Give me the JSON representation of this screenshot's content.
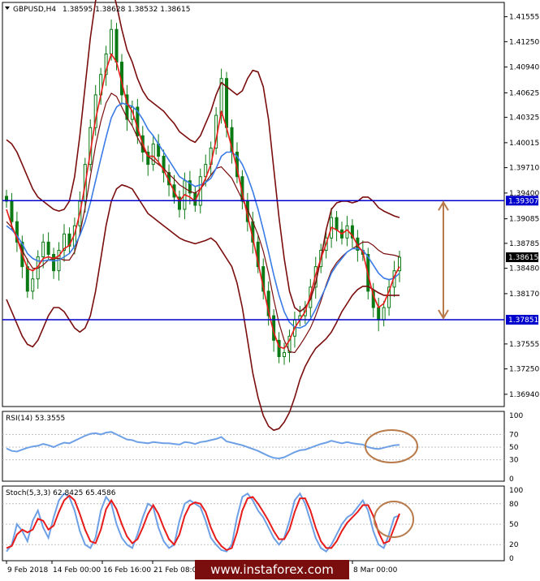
{
  "header": {
    "symbol": "GBPUSD,H4",
    "ohlc": "1.38595 1.38628 1.38532 1.38615"
  },
  "rsi_header": {
    "label": "RSI(14) 53.3555"
  },
  "stoch_header": {
    "label": "Stoch(5,3,3) 62.8425 65.4586"
  },
  "watermark": {
    "text": "www.instaforex.com"
  },
  "colors": {
    "background": "#ffffff",
    "candle": "#0b7a14",
    "bollinger": "#7a0d0d",
    "ma_fast": "#e81b1b",
    "ma_slow": "#3a7be6",
    "level_line": "#0000cc",
    "level_badge": "#0000cc",
    "last_price_badge": "#000000",
    "annotation": "#b87a4a",
    "indicator_line": "#6ea0e6",
    "stoch_signal": "#e81b1b",
    "watermark_bar": "#7a0d0d"
  },
  "chart_data": [
    {
      "type": "candlestick",
      "panel": "price",
      "ylim": [
        1.368,
        1.417
      ],
      "y_ticks": [
        "1.41555",
        "1.41250",
        "1.40940",
        "1.40625",
        "1.40325",
        "1.40015",
        "1.39710",
        "1.39400",
        "1.39085",
        "1.38785",
        "1.38480",
        "1.38170",
        "1.37555",
        "1.37250",
        "1.36940"
      ],
      "levels": [
        {
          "name": "resistance",
          "value": 1.39307,
          "label": "1.39307"
        },
        {
          "name": "support",
          "value": 1.37851,
          "label": "1.37851"
        }
      ],
      "last_price": {
        "value": 1.38615,
        "label": "1.38615"
      },
      "x_ticks": [
        "9 Feb 2018",
        "14 Feb 00:00",
        "16 Feb 16:00",
        "21 Feb 08:00",
        "8 Mar 00:00"
      ],
      "close": [
        1.393,
        1.3905,
        1.388,
        1.385,
        1.382,
        1.3835,
        1.3862,
        1.388,
        1.3865,
        1.3845,
        1.387,
        1.389,
        1.3875,
        1.39,
        1.393,
        1.3975,
        1.402,
        1.406,
        1.4085,
        1.411,
        1.414,
        1.41,
        1.406,
        1.403,
        1.4045,
        1.401,
        1.399,
        1.3975,
        1.4,
        1.3985,
        1.3965,
        1.395,
        1.3935,
        1.392,
        1.3955,
        1.394,
        1.3925,
        1.396,
        1.3975,
        1.3995,
        1.4035,
        1.408,
        1.402,
        1.399,
        1.396,
        1.393,
        1.3905,
        1.388,
        1.385,
        1.382,
        1.379,
        1.376,
        1.374,
        1.3745,
        1.3765,
        1.3785,
        1.379,
        1.38,
        1.3825,
        1.385,
        1.387,
        1.3885,
        1.391,
        1.3895,
        1.3885,
        1.39,
        1.3885,
        1.387,
        1.3865,
        1.382,
        1.38,
        1.3785,
        1.38,
        1.3825,
        1.3845,
        1.38615
      ],
      "ma_fast": [
        1.392,
        1.39,
        1.3885,
        1.3865,
        1.3848,
        1.3845,
        1.385,
        1.386,
        1.3862,
        1.386,
        1.3863,
        1.3872,
        1.3876,
        1.389,
        1.3915,
        1.395,
        1.399,
        1.403,
        1.406,
        1.409,
        1.411,
        1.41,
        1.4075,
        1.405,
        1.404,
        1.402,
        1.4,
        1.3985,
        1.3985,
        1.3978,
        1.3968,
        1.3955,
        1.3942,
        1.393,
        1.3938,
        1.3935,
        1.393,
        1.3945,
        1.3958,
        1.3975,
        1.4005,
        1.404,
        1.402,
        1.3995,
        1.397,
        1.394,
        1.3912,
        1.3885,
        1.3855,
        1.3825,
        1.3795,
        1.377,
        1.3752,
        1.375,
        1.376,
        1.3775,
        1.3785,
        1.3795,
        1.3815,
        1.384,
        1.386,
        1.3878,
        1.3898,
        1.3895,
        1.389,
        1.3895,
        1.3888,
        1.3876,
        1.3868,
        1.384,
        1.3815,
        1.38,
        1.3805,
        1.382,
        1.3838,
        1.385
      ],
      "ma_slow": [
        1.39,
        1.3895,
        1.3888,
        1.3878,
        1.3866,
        1.386,
        1.3857,
        1.3857,
        1.3858,
        1.3857,
        1.3858,
        1.3862,
        1.3866,
        1.3875,
        1.3888,
        1.3905,
        1.3928,
        1.3955,
        1.3982,
        1.4008,
        1.4032,
        1.4045,
        1.405,
        1.4048,
        1.4046,
        1.404,
        1.403,
        1.4018,
        1.401,
        1.4,
        1.399,
        1.398,
        1.397,
        1.396,
        1.3956,
        1.3952,
        1.3948,
        1.395,
        1.3953,
        1.3958,
        1.397,
        1.3985,
        1.399,
        1.399,
        1.3985,
        1.3975,
        1.396,
        1.3942,
        1.392,
        1.3895,
        1.3868,
        1.384,
        1.3815,
        1.3795,
        1.3782,
        1.3776,
        1.3775,
        1.3778,
        1.3786,
        1.3798,
        1.3812,
        1.3826,
        1.3842,
        1.3852,
        1.386,
        1.3868,
        1.3872,
        1.3872,
        1.387,
        1.3862,
        1.3852,
        1.3842,
        1.3836,
        1.3834,
        1.3836,
        1.3842
      ],
      "bb_upper": [
        1.4005,
        1.4,
        1.399,
        1.3975,
        1.396,
        1.3945,
        1.3935,
        1.393,
        1.3925,
        1.392,
        1.3918,
        1.392,
        1.393,
        1.396,
        1.401,
        1.407,
        1.413,
        1.4175,
        1.4195,
        1.42,
        1.4195,
        1.417,
        1.414,
        1.4115,
        1.41,
        1.408,
        1.4065,
        1.4055,
        1.405,
        1.4045,
        1.404,
        1.4032,
        1.4025,
        1.4015,
        1.401,
        1.4005,
        1.4002,
        1.401,
        1.4025,
        1.404,
        1.406,
        1.4075,
        1.407,
        1.4065,
        1.406,
        1.4065,
        1.408,
        1.409,
        1.4088,
        1.407,
        1.403,
        1.397,
        1.391,
        1.386,
        1.382,
        1.38,
        1.3795,
        1.38,
        1.381,
        1.383,
        1.386,
        1.3895,
        1.392,
        1.3928,
        1.393,
        1.393,
        1.3928,
        1.393,
        1.3935,
        1.3935,
        1.393,
        1.3922,
        1.3918,
        1.3915,
        1.3912,
        1.391
      ],
      "bb_lower": [
        1.381,
        1.3795,
        1.378,
        1.3765,
        1.3755,
        1.3752,
        1.376,
        1.3775,
        1.379,
        1.38,
        1.38,
        1.3795,
        1.3785,
        1.3775,
        1.377,
        1.3775,
        1.379,
        1.382,
        1.386,
        1.39,
        1.393,
        1.3945,
        1.395,
        1.3948,
        1.3945,
        1.3935,
        1.3925,
        1.3915,
        1.391,
        1.3905,
        1.39,
        1.3895,
        1.389,
        1.3885,
        1.3882,
        1.388,
        1.3878,
        1.388,
        1.3882,
        1.3885,
        1.388,
        1.387,
        1.386,
        1.385,
        1.383,
        1.38,
        1.376,
        1.372,
        1.369,
        1.3668,
        1.3655,
        1.365,
        1.3652,
        1.366,
        1.3672,
        1.369,
        1.3712,
        1.3728,
        1.374,
        1.375,
        1.3756,
        1.3762,
        1.377,
        1.3782,
        1.3795,
        1.3805,
        1.3815,
        1.3822,
        1.3826,
        1.3826,
        1.3822,
        1.3818,
        1.3815,
        1.3815,
        1.3815,
        1.3815
      ],
      "bb_mid": [
        1.3905,
        1.3898,
        1.3885,
        1.387,
        1.3858,
        1.3848,
        1.3848,
        1.3852,
        1.3858,
        1.386,
        1.386,
        1.3858,
        1.3858,
        1.3868,
        1.389,
        1.3922,
        1.396,
        1.3998,
        1.4028,
        1.405,
        1.4062,
        1.4058,
        1.4045,
        1.4032,
        1.4022,
        1.4008,
        1.3995,
        1.3985,
        1.398,
        1.3975,
        1.397,
        1.3963,
        1.3957,
        1.395,
        1.3946,
        1.3942,
        1.394,
        1.3945,
        1.3953,
        1.3962,
        1.397,
        1.3972,
        1.3965,
        1.3958,
        1.3945,
        1.3932,
        1.392,
        1.3905,
        1.3889,
        1.3869,
        1.3842,
        1.381,
        1.3781,
        1.376,
        1.3746,
        1.3745,
        1.3754,
        1.3764,
        1.3775,
        1.379,
        1.3808,
        1.3828,
        1.3845,
        1.3855,
        1.3862,
        1.3868,
        1.3872,
        1.3876,
        1.388,
        1.388,
        1.3876,
        1.387,
        1.3866,
        1.3865,
        1.3864,
        1.3862
      ]
    },
    {
      "type": "line",
      "panel": "rsi",
      "label": "RSI(14) 53.3555",
      "ylim": [
        0,
        100
      ],
      "y_ticks": [
        "100",
        "70",
        "50",
        "30",
        "0"
      ],
      "values": [
        48,
        44,
        43,
        46,
        49,
        51,
        52,
        55,
        53,
        50,
        54,
        57,
        56,
        60,
        64,
        68,
        71,
        72,
        70,
        73,
        74,
        70,
        66,
        62,
        61,
        58,
        57,
        56,
        58,
        57,
        56,
        56,
        55,
        54,
        58,
        57,
        55,
        58,
        59,
        61,
        63,
        66,
        59,
        57,
        55,
        53,
        50,
        47,
        44,
        40,
        36,
        33,
        32,
        34,
        38,
        42,
        45,
        46,
        49,
        52,
        55,
        57,
        60,
        58,
        56,
        58,
        56,
        55,
        54,
        50,
        48,
        47,
        49,
        51,
        53,
        53.4
      ]
    },
    {
      "type": "line",
      "panel": "stoch",
      "label": "Stoch(5,3,3) 62.8425 65.4586",
      "ylim": [
        0,
        100
      ],
      "y_ticks": [
        "100",
        "80",
        "50",
        "20",
        "0"
      ],
      "main": [
        10,
        20,
        50,
        40,
        25,
        55,
        70,
        45,
        30,
        60,
        85,
        95,
        90,
        70,
        40,
        20,
        15,
        30,
        70,
        90,
        80,
        50,
        30,
        20,
        15,
        35,
        60,
        80,
        75,
        45,
        25,
        15,
        20,
        55,
        80,
        85,
        80,
        75,
        55,
        30,
        20,
        12,
        10,
        20,
        60,
        90,
        95,
        85,
        70,
        60,
        45,
        30,
        20,
        30,
        55,
        85,
        95,
        80,
        55,
        30,
        15,
        10,
        20,
        35,
        50,
        60,
        65,
        75,
        85,
        70,
        40,
        20,
        15,
        35,
        60,
        62.8
      ],
      "signal": [
        15,
        18,
        35,
        42,
        38,
        42,
        58,
        55,
        42,
        48,
        68,
        85,
        92,
        85,
        65,
        42,
        25,
        22,
        42,
        72,
        85,
        72,
        50,
        32,
        22,
        28,
        45,
        65,
        78,
        65,
        45,
        28,
        20,
        35,
        62,
        78,
        82,
        80,
        68,
        45,
        28,
        18,
        12,
        15,
        38,
        70,
        88,
        90,
        80,
        68,
        55,
        40,
        28,
        28,
        42,
        68,
        88,
        88,
        70,
        45,
        25,
        15,
        15,
        25,
        40,
        52,
        60,
        68,
        78,
        78,
        62,
        38,
        22,
        25,
        45,
        65.5
      ]
    }
  ]
}
